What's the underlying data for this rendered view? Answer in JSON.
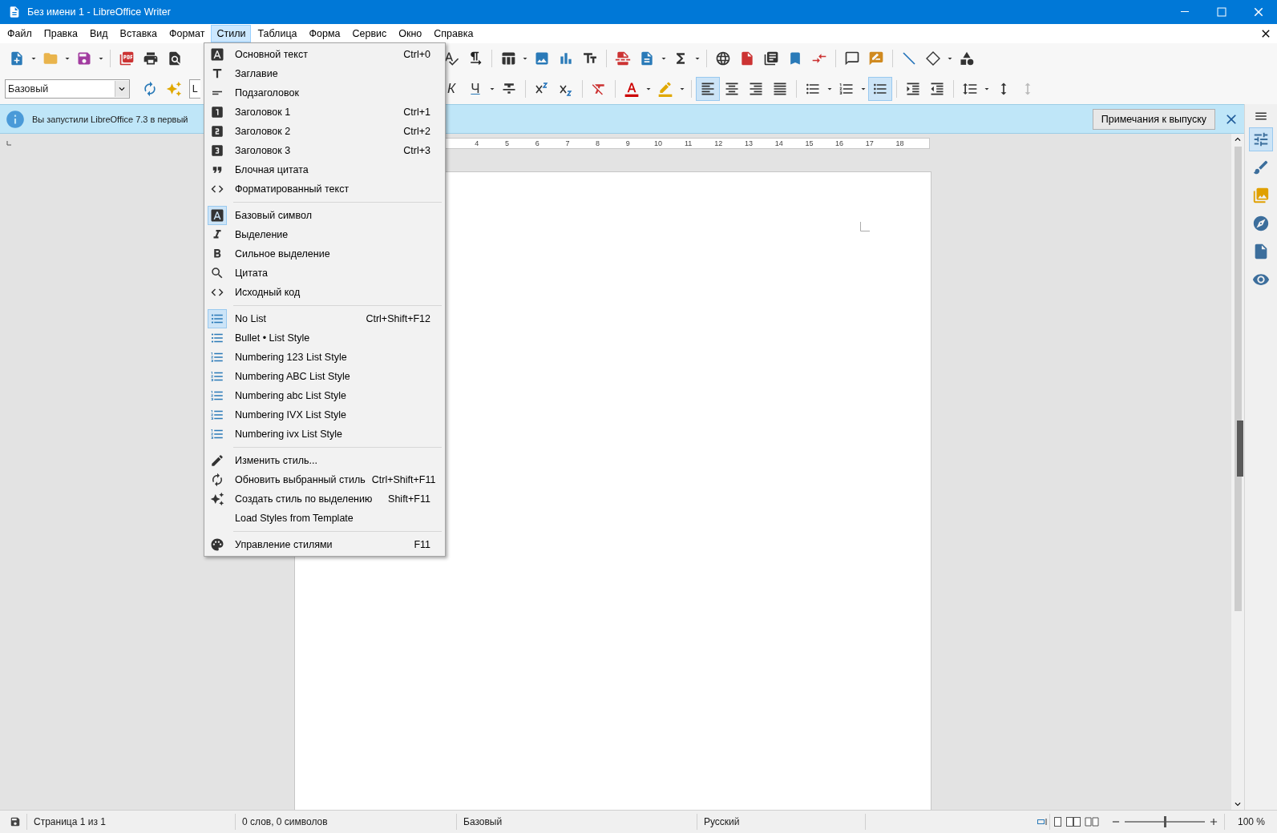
{
  "window": {
    "title": "Без имени 1 - LibreOffice Writer"
  },
  "menu_bar": [
    {
      "label": "Файл",
      "selected": false
    },
    {
      "label": "Правка",
      "selected": false
    },
    {
      "label": "Вид",
      "selected": false
    },
    {
      "label": "Вставка",
      "selected": false
    },
    {
      "label": "Формат",
      "selected": false
    },
    {
      "label": "Стили",
      "selected": true
    },
    {
      "label": "Таблица",
      "selected": false
    },
    {
      "label": "Форма",
      "selected": false
    },
    {
      "label": "Сервис",
      "selected": false
    },
    {
      "label": "Окно",
      "selected": false
    },
    {
      "label": "Справка",
      "selected": false
    }
  ],
  "formatting_toolbar": {
    "paragraph_style": "Базовый",
    "font_name": "L",
    "buttons": [
      {
        "kind": "letter-italic",
        "label": "К",
        "selected": false
      },
      {
        "kind": "letter-underline",
        "label": "Ч",
        "selected": false
      },
      {
        "kind": "strikethrough",
        "selected": false
      },
      {
        "kind": "superscript",
        "selected": false
      },
      {
        "kind": "subscript",
        "selected": false
      },
      {
        "kind": "clear-formatting",
        "selected": false
      },
      {
        "kind": "font-color",
        "selected": false
      },
      {
        "kind": "highlight",
        "selected": false
      },
      {
        "kind": "align-left",
        "selected": true
      },
      {
        "kind": "align-center",
        "selected": false
      },
      {
        "kind": "align-right",
        "selected": false
      },
      {
        "kind": "align-justify",
        "selected": false
      },
      {
        "kind": "bullets",
        "selected": false
      },
      {
        "kind": "numbering",
        "selected": false
      },
      {
        "kind": "no-list",
        "selected": true
      },
      {
        "kind": "indent-increase",
        "selected": false
      },
      {
        "kind": "indent-decrease",
        "selected": false
      },
      {
        "kind": "line-spacing",
        "selected": false
      },
      {
        "kind": "paragraph-spacing",
        "selected": false
      },
      {
        "kind": "paragraph-spacing-decrease",
        "selected": false
      }
    ]
  },
  "info_bar": {
    "message": "Вы запустили LibreOffice 7.3 в первый",
    "button": "Примечания к выпуску"
  },
  "ruler": {
    "labels": [
      "4",
      "5",
      "6",
      "7",
      "8",
      "9",
      "10",
      "11",
      "12",
      "13",
      "14",
      "15",
      "16",
      "17",
      "18"
    ]
  },
  "styles_menu": {
    "groups": [
      [
        {
          "label": "Основной текст",
          "shortcut": "Ctrl+0",
          "checked": false
        },
        {
          "label": "Заглавие",
          "checked": false
        },
        {
          "label": "Подзаголовок",
          "checked": false
        },
        {
          "label": "Заголовок 1",
          "shortcut": "Ctrl+1",
          "checked": false
        },
        {
          "label": "Заголовок 2",
          "shortcut": "Ctrl+2",
          "checked": false
        },
        {
          "label": "Заголовок 3",
          "shortcut": "Ctrl+3",
          "checked": false
        },
        {
          "label": "Блочная цитата",
          "checked": false
        },
        {
          "label": "Форматированный текст",
          "checked": false
        }
      ],
      [
        {
          "label": "Базовый символ",
          "checked": true
        },
        {
          "label": "Выделение",
          "checked": false
        },
        {
          "label": "Сильное выделение",
          "checked": false
        },
        {
          "label": "Цитата",
          "checked": false
        },
        {
          "label": "Исходный код",
          "checked": false
        }
      ],
      [
        {
          "label": "No List",
          "shortcut": "Ctrl+Shift+F12",
          "checked": true
        },
        {
          "label": "Bullet • List Style",
          "checked": false
        },
        {
          "label": "Numbering 123 List Style",
          "checked": false
        },
        {
          "label": "Numbering ABC List Style",
          "checked": false
        },
        {
          "label": "Numbering abc List Style",
          "checked": false
        },
        {
          "label": "Numbering IVX List Style",
          "checked": false
        },
        {
          "label": "Numbering ivx List Style",
          "checked": false
        }
      ],
      [
        {
          "label": "Изменить стиль...",
          "checked": false
        },
        {
          "label": "Обновить выбранный стиль",
          "shortcut": "Ctrl+Shift+F11",
          "checked": false
        },
        {
          "label": "Создать стиль по выделению",
          "shortcut": "Shift+F11",
          "checked": false
        },
        {
          "label": "Load Styles from Template",
          "checked": false
        }
      ],
      [
        {
          "label": "Управление стилями",
          "shortcut": "F11",
          "checked": false
        }
      ]
    ]
  },
  "sidebar": {
    "decks": [
      {
        "selected": true
      },
      {
        "selected": false
      },
      {
        "selected": false
      },
      {
        "selected": false
      },
      {
        "selected": false
      },
      {
        "selected": false
      }
    ]
  },
  "status_bar": {
    "page": "Страница 1 из 1",
    "words": "0 слов, 0 символов",
    "page_style": "Базовый",
    "language": "Русский",
    "zoom_slider": {
      "level": 0.5
    },
    "zoom": "100 %"
  }
}
